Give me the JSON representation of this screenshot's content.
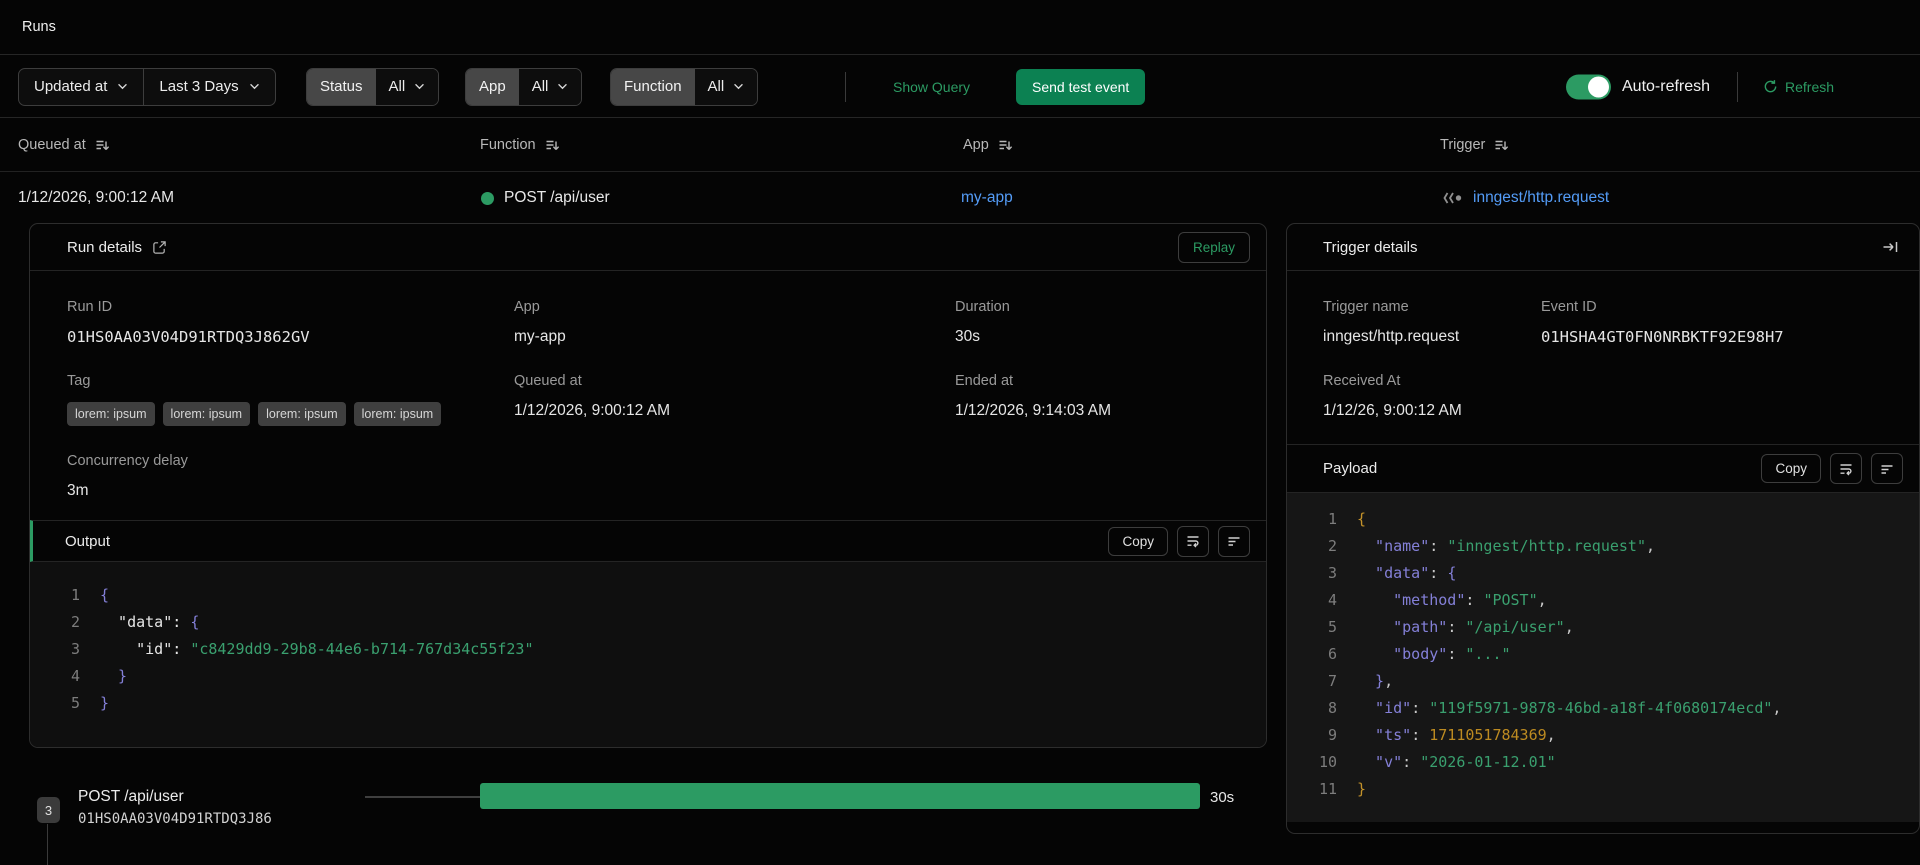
{
  "page": {
    "title": "Runs"
  },
  "colors": {
    "accent_green": "#2c9b63",
    "button_green": "#0c8152",
    "link_blue": "#549cf7",
    "code_key_purple": "#8480d8",
    "code_string_green": "#3aa06f",
    "code_number_gold": "#bd8b21"
  },
  "filters": {
    "sort_field": "Updated at",
    "time_range": "Last 3 Days",
    "status": {
      "label": "Status",
      "value": "All"
    },
    "app": {
      "label": "App",
      "value": "All"
    },
    "function": {
      "label": "Function",
      "value": "All"
    },
    "show_query": "Show Query",
    "send_test_event": "Send test event",
    "auto_refresh": "Auto-refresh",
    "refresh": "Refresh"
  },
  "table": {
    "columns": [
      "Queued at",
      "Function",
      "App",
      "Trigger"
    ],
    "row": {
      "queued_at": "1/12/2026, 9:00:12 AM",
      "function": "POST /api/user",
      "app": "my-app",
      "trigger": "inngest/http.request"
    }
  },
  "run_details": {
    "title": "Run details",
    "replay": "Replay",
    "fields": {
      "run_id": {
        "label": "Run ID",
        "value": "01HS0AA03V04D91RTDQ3J862GV"
      },
      "app": {
        "label": "App",
        "value": "my-app"
      },
      "duration": {
        "label": "Duration",
        "value": "30s"
      },
      "tag": {
        "label": "Tag",
        "chips": [
          "lorem: ipsum",
          "lorem: ipsum",
          "lorem: ipsum",
          "lorem: ipsum"
        ]
      },
      "queued_at": {
        "label": "Queued at",
        "value": "1/12/2026, 9:00:12 AM"
      },
      "ended_at": {
        "label": "Ended at",
        "value": "1/12/2026, 9:14:03 AM"
      },
      "concurrency_delay": {
        "label": "Concurrency delay",
        "value": "3m"
      }
    },
    "output": {
      "title": "Output",
      "copy": "Copy",
      "code": [
        [
          [
            "pbrace",
            "{"
          ]
        ],
        [
          [
            "okey",
            "  \"data\""
          ],
          [
            "opunc",
            ": "
          ],
          [
            "pbrace",
            "{"
          ]
        ],
        [
          [
            "okey",
            "    \"id\""
          ],
          [
            "opunc",
            ": "
          ],
          [
            "str",
            "\"c8429dd9-29b8-44e6-b714-767d34c55f23\""
          ]
        ],
        [
          [
            "pbrace",
            "  }"
          ]
        ],
        [
          [
            "pbrace",
            "}"
          ]
        ]
      ]
    }
  },
  "trigger_details": {
    "title": "Trigger details",
    "fields": {
      "trigger_name": {
        "label": "Trigger name",
        "value": "inngest/http.request"
      },
      "event_id": {
        "label": "Event ID",
        "value": "01HSHA4GT0FN0NRBKTF92E98H7"
      },
      "received_at": {
        "label": "Received At",
        "value": "1/12/26, 9:00:12 AM"
      }
    },
    "payload": {
      "title": "Payload",
      "copy": "Copy",
      "code": [
        [
          [
            "gbrace",
            "{"
          ]
        ],
        [
          [
            "pkey",
            "  \"name\""
          ],
          [
            "punc",
            ": "
          ],
          [
            "str",
            "\"inngest/http.request\""
          ],
          [
            "punc",
            ","
          ]
        ],
        [
          [
            "pkey",
            "  \"data\""
          ],
          [
            "punc",
            ": "
          ],
          [
            "pbrace",
            "{"
          ]
        ],
        [
          [
            "pkey",
            "    \"method\""
          ],
          [
            "punc",
            ": "
          ],
          [
            "str",
            "\"POST\""
          ],
          [
            "punc",
            ","
          ]
        ],
        [
          [
            "pkey",
            "    \"path\""
          ],
          [
            "punc",
            ": "
          ],
          [
            "str",
            "\"/api/user\""
          ],
          [
            "punc",
            ","
          ]
        ],
        [
          [
            "pkey",
            "    \"body\""
          ],
          [
            "punc",
            ": "
          ],
          [
            "str",
            "\"...\""
          ]
        ],
        [
          [
            "pbrace",
            "  }"
          ],
          [
            "punc",
            ","
          ]
        ],
        [
          [
            "pkey",
            "  \"id\""
          ],
          [
            "punc",
            ": "
          ],
          [
            "str",
            "\"119f5971-9878-46bd-a18f-4f0680174ecd\""
          ],
          [
            "punc",
            ","
          ]
        ],
        [
          [
            "pkey",
            "  \"ts\""
          ],
          [
            "punc",
            ": "
          ],
          [
            "num",
            "1711051784369"
          ],
          [
            "punc",
            ","
          ]
        ],
        [
          [
            "pkey",
            "  \"v\""
          ],
          [
            "punc",
            ": "
          ],
          [
            "str",
            "\"2026-01-12.01\""
          ]
        ],
        [
          [
            "gbrace",
            "}"
          ]
        ]
      ]
    }
  },
  "timeline": {
    "step_count": "3",
    "step_name": "POST /api/user",
    "step_id": "01HS0AA03V04D91RTDQ3J86",
    "duration": "30s"
  }
}
